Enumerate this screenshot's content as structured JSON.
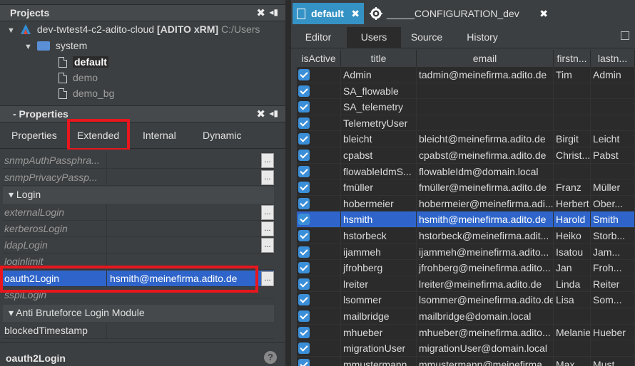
{
  "projects": {
    "title": "Projects",
    "close": "✖",
    "pin": "◂▮",
    "tree": [
      {
        "label": "dev-twtest4-c2-adito-cloud",
        "bold": "[ADITO xRM]",
        "path": "C:/Users"
      },
      {
        "label": "system"
      },
      {
        "label": "default"
      },
      {
        "label": "demo"
      },
      {
        "label": "demo_bg"
      }
    ]
  },
  "properties": {
    "title": "- Properties",
    "close": "✖",
    "pin": "◂▮",
    "tabs": [
      "Properties",
      "Extended",
      "Internal",
      "Dynamic"
    ],
    "rows": [
      {
        "name": "snmpAuthPassphra...",
        "value": ""
      },
      {
        "name": "snmpPrivacyPassp...",
        "value": ""
      }
    ],
    "group_login": "Login",
    "login_rows": [
      {
        "name": "externalLogin",
        "value": ""
      },
      {
        "name": "kerberosLogin",
        "value": ""
      },
      {
        "name": "ldapLogin",
        "value": ""
      },
      {
        "name": "loginlimit",
        "value": ""
      },
      {
        "name": "oauth2Login",
        "value": "hsmith@meinefirma.adito.de"
      },
      {
        "name": "sspiLogin",
        "value": ""
      }
    ],
    "group_brute": "Anti Bruteforce Login Module",
    "brute_rows": [
      {
        "name": "blockedTimestamp",
        "value": ""
      }
    ],
    "dots": "...",
    "description_title": "oauth2Login",
    "help": "?"
  },
  "editor": {
    "doc_tabs": [
      {
        "label": "default",
        "close": "✖"
      },
      {
        "label": "_____CONFIGURATION_dev",
        "close": "✖"
      }
    ],
    "tabs": [
      "Editor",
      "Users",
      "Source",
      "History"
    ],
    "columns": [
      "isActive",
      "title",
      "email",
      "firstn...",
      "lastn..."
    ],
    "rows": [
      {
        "title": "Admin",
        "email": "tadmin@meinefirma.adito.de",
        "first": "Tim",
        "last": "Admin"
      },
      {
        "title": "SA_flowable",
        "email": "",
        "first": "",
        "last": ""
      },
      {
        "title": "SA_telemetry",
        "email": "",
        "first": "",
        "last": ""
      },
      {
        "title": "TelemetryUser",
        "email": "",
        "first": "",
        "last": ""
      },
      {
        "title": "bleicht",
        "email": "bleicht@meinefirma.adito.de",
        "first": "Birgit",
        "last": "Leicht"
      },
      {
        "title": "cpabst",
        "email": "cpabst@meinefirma.adito.de",
        "first": "Christ...",
        "last": "Pabst"
      },
      {
        "title": "flowableIdmS...",
        "email": "flowableIdm@domain.local",
        "first": "",
        "last": ""
      },
      {
        "title": "fmüller",
        "email": "fmüller@meinefirma.adito.de",
        "first": "Franz",
        "last": "Müller"
      },
      {
        "title": "hobermeier",
        "email": "hobermeier@meinefirma.adi...",
        "first": "Herbert",
        "last": "Ober..."
      },
      {
        "title": "hsmith",
        "email": "hsmith@meinefirma.adito.de",
        "first": "Harold",
        "last": "Smith"
      },
      {
        "title": "hstorbeck",
        "email": "hstorbeck@meinefirma.adit...",
        "first": "Heiko",
        "last": "Storb..."
      },
      {
        "title": "ijammeh",
        "email": "ijammeh@meinefirma.adito...",
        "first": "Isatou",
        "last": "Jam..."
      },
      {
        "title": "jfrohberg",
        "email": "jfrohberg@meinefirma.adito...",
        "first": "Jan",
        "last": "Froh..."
      },
      {
        "title": "lreiter",
        "email": "lreiter@meinefirma.adito.de",
        "first": "Linda",
        "last": "Reiter"
      },
      {
        "title": "lsommer",
        "email": "lsommer@meinefirma.adito.de",
        "first": "Lisa",
        "last": "Som..."
      },
      {
        "title": "mailbridge",
        "email": "mailbridge@domain.local",
        "first": "",
        "last": ""
      },
      {
        "title": "mhueber",
        "email": "mhueber@meinefirma.adito...",
        "first": "Melanie",
        "last": "Hueber"
      },
      {
        "title": "migrationUser",
        "email": "migrationUser@domain.local",
        "first": "",
        "last": ""
      },
      {
        "title": "mmustermann",
        "email": "mmustermann@meinefirma...",
        "first": "Max",
        "last": "Must..."
      }
    ],
    "selected_row": 9
  },
  "colors": {
    "accent": "#3592c4",
    "selection": "#2f65ca",
    "highlight_box": "#e8161d"
  }
}
